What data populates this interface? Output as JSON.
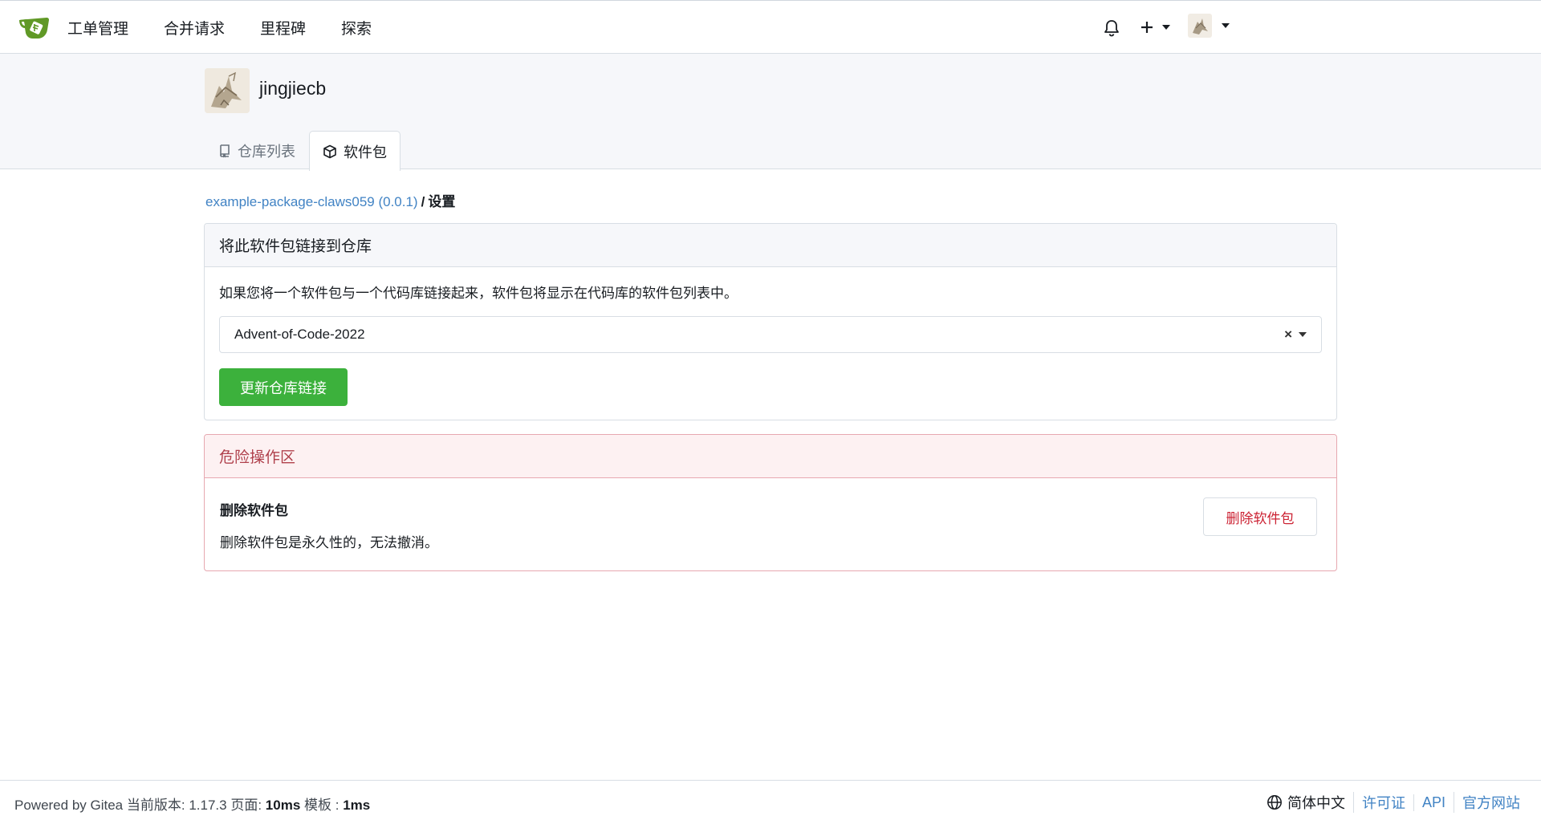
{
  "nav": {
    "links": [
      "工单管理",
      "合并请求",
      "里程碑",
      "探索"
    ]
  },
  "profile": {
    "username": "jingjiecb",
    "tabs": [
      {
        "label": "仓库列表",
        "icon": "repo-icon",
        "active": false
      },
      {
        "label": "软件包",
        "icon": "package-icon",
        "active": true
      }
    ]
  },
  "breadcrumb": {
    "package_link": "example-package-claws059 (0.0.1)",
    "separator": "/",
    "current": "设置"
  },
  "link_section": {
    "title": "将此软件包链接到仓库",
    "description": "如果您将一个软件包与一个代码库链接起来，软件包将显示在代码库的软件包列表中。",
    "selected_repo": "Advent-of-Code-2022",
    "clear_symbol": "×",
    "update_button": "更新仓库链接"
  },
  "danger_section": {
    "title": "危险操作区",
    "delete_title": "删除软件包",
    "delete_description": "删除软件包是永久性的，无法撤消。",
    "delete_button": "删除软件包"
  },
  "footer": {
    "powered": "Powered by Gitea",
    "version_label": "当前版本: 1.17.3",
    "page_label": "页面:",
    "page_time": "10ms",
    "template_label": "模板 :",
    "template_time": "1ms",
    "language": "简体中文",
    "links": [
      "许可证",
      "API",
      "官方网站"
    ]
  },
  "colors": {
    "primary_green": "#3cb13c",
    "link_blue": "#4183c4",
    "danger_red": "#cc2233"
  }
}
